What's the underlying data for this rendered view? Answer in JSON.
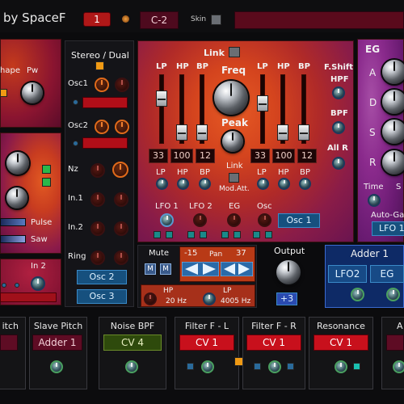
{
  "header": {
    "brand": "by SpaceF",
    "preset_number": "1",
    "note": "C-2",
    "skin_label": "Skin"
  },
  "osc_left": {
    "shape_label": "hape",
    "pw_label": "Pw",
    "pulse_label": "Pulse",
    "saw_label": "Saw",
    "in2_label": "In 2"
  },
  "stereo_dual": {
    "title": "Stereo / Dual",
    "osc1_label": "Osc1",
    "osc2_label": "Osc2",
    "nz_label": "Nz",
    "in1_label": "In.1",
    "in2_label": "In.2",
    "ring_label": "Ring",
    "osc2_button": "Osc 2",
    "osc3_button": "Osc 3"
  },
  "filter": {
    "link_label": "Link",
    "freq_label": "Freq",
    "peak_label": "Peak",
    "fshift_label": "F.Shift",
    "hpf_label": "HPF",
    "bpf_label": "BPF",
    "allr_label": "All R",
    "left_headers": [
      "LP",
      "HP",
      "BP"
    ],
    "right_headers": [
      "LP",
      "HP",
      "BP"
    ],
    "left_values": [
      "33",
      "100",
      "12"
    ],
    "right_values": [
      "33",
      "100",
      "12"
    ],
    "knob_labels_left": [
      "LP",
      "HP",
      "BP"
    ],
    "knob_labels_right": [
      "LP",
      "HP",
      "BP"
    ],
    "link2_label": "Link",
    "modatt_label": "Mod.Att.",
    "mod_labels": [
      "LFO 1",
      "LFO 2",
      "EG",
      "Osc"
    ],
    "osc1_button": "Osc 1"
  },
  "mixer": {
    "mute_label": "Mute",
    "m_label": "M",
    "pan_left": "-15",
    "pan_label": "Pan",
    "pan_right": "37",
    "hp_label": "HP",
    "hp_value": "20 Hz",
    "lp_label": "LP",
    "lp_value": "4005 Hz",
    "output_label": "Output",
    "output_value": "+3"
  },
  "eg": {
    "title": "EG",
    "a_label": "A",
    "d_label": "D",
    "s_label": "S",
    "r_label": "R",
    "time_label": "Time",
    "s2_label": "S",
    "autogate_label": "Auto-Ga",
    "lfo_display": "LFO 1"
  },
  "adder": {
    "title": "Adder 1",
    "lfo2": "LFO2",
    "eg": "EG"
  },
  "bottom": {
    "pitch_title": "itch",
    "slave_title": "Slave Pitch",
    "slave_value": "Adder 1",
    "noise_title": "Noise BPF",
    "noise_value": "CV 4",
    "filter_l_title": "Filter F - L",
    "filter_l_value": "CV 1",
    "filter_r_title": "Filter F - R",
    "filter_r_value": "CV 1",
    "res_title": "Resonance",
    "res_value": "CV 1",
    "a_title": "A"
  },
  "colors": {
    "accent_red": "#c8101c",
    "accent_blue": "#16507e",
    "accent_orange": "#f09a14",
    "panel_purple": "#8a2a8c"
  }
}
